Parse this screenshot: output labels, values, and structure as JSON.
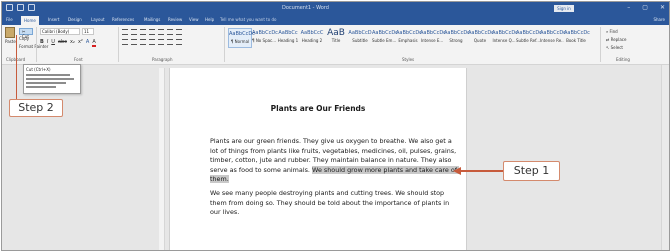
{
  "window": {
    "title": "Document1 - Word",
    "sign_in": "Sign in",
    "controls": [
      "–",
      "▢",
      "✕"
    ]
  },
  "tabs": [
    {
      "label": "File"
    },
    {
      "label": "Home"
    },
    {
      "label": "Insert"
    },
    {
      "label": "Design"
    },
    {
      "label": "Layout"
    },
    {
      "label": "References"
    },
    {
      "label": "Mailings"
    },
    {
      "label": "Review"
    },
    {
      "label": "View"
    },
    {
      "label": "Help"
    }
  ],
  "tell_me": "Tell me what you want to do",
  "share": "Share",
  "ribbon": {
    "paste": "Paste",
    "cut": "Cut",
    "copy": "Copy",
    "format_painter": "Format Painter",
    "font_name": "Calibri (Body)",
    "font_size": "11",
    "format_glyphs": [
      "B",
      "I",
      "U",
      "abc",
      "x₂",
      "x²",
      "A",
      "A"
    ],
    "styles": [
      {
        "sample": "AaBbCcDc",
        "name": "¶ Normal",
        "big": false,
        "selected": true
      },
      {
        "sample": "AaBbCcDc",
        "name": "¶ No Spac...",
        "big": false,
        "selected": false
      },
      {
        "sample": "AaBbCc",
        "name": "Heading 1",
        "big": false,
        "selected": false
      },
      {
        "sample": "AaBbCcC",
        "name": "Heading 2",
        "big": false,
        "selected": false
      },
      {
        "sample": "AaB",
        "name": "Title",
        "big": true,
        "selected": false
      },
      {
        "sample": "AaBbCcD",
        "name": "Subtitle",
        "big": false,
        "selected": false
      },
      {
        "sample": "AaBbCcDc",
        "name": "Subtle Em...",
        "big": false,
        "selected": false
      },
      {
        "sample": "AaBbCcDc",
        "name": "Emphasis",
        "big": false,
        "selected": false
      },
      {
        "sample": "AaBbCcDc",
        "name": "Intense E...",
        "big": false,
        "selected": false
      },
      {
        "sample": "AaBbCcDc",
        "name": "Strong",
        "big": false,
        "selected": false
      },
      {
        "sample": "AaBbCcDc",
        "name": "Quote",
        "big": false,
        "selected": false
      },
      {
        "sample": "AaBbCcDc",
        "name": "Intense Q...",
        "big": false,
        "selected": false
      },
      {
        "sample": "AaBbCcDc",
        "name": "Subtle Ref...",
        "big": false,
        "selected": false
      },
      {
        "sample": "AaBbCcDc",
        "name": "Intense Re...",
        "big": false,
        "selected": false
      },
      {
        "sample": "AaBbCcDc",
        "name": "Book Title",
        "big": false,
        "selected": false
      }
    ],
    "editing": [
      "Find",
      "Replace",
      "Select"
    ],
    "group_labels": {
      "clipboard": "Clipboard",
      "font": "Font",
      "paragraph": "Paragraph",
      "styles": "Styles",
      "editing": "Editing"
    }
  },
  "tooltip": {
    "title": "Cut (Ctrl+X)"
  },
  "callouts": {
    "step1": "Step 1",
    "step2": "Step 2"
  },
  "document": {
    "heading": "Plants are Our Friends",
    "p1_plain": "Plants are our green friends. They give us oxygen to breathe. We also get a lot of things from plants like fruits, vegetables, medicines, oil, pulses, grains, timber, cotton, jute and rubber. They maintain balance in nature. They also serve as food to some animals. ",
    "p1_selected": "We should grow more plants and take care of them.",
    "p2": "We see many people destroying plants and cutting trees. We should stop them from doing so. They should be told about the importance of plants in our lives."
  }
}
